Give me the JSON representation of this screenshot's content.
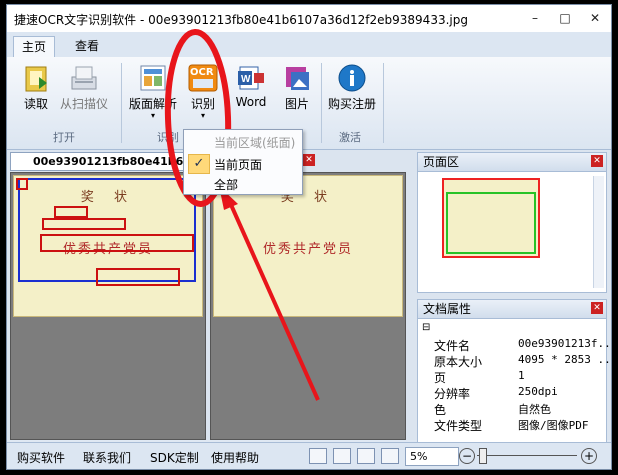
{
  "window": {
    "title": "捷速OCR文字识别软件 - 00e93901213fb80e41b6107a36d12f2eb9389433.jpg",
    "controls": [
      "–",
      "□",
      "✕"
    ]
  },
  "ribbon_tabs": [
    "主页",
    "查看"
  ],
  "ribbon": {
    "buttons": {
      "read": "读取",
      "scan": "从扫描仪",
      "layout": "版面解析",
      "recognize": "识别",
      "word": "Word",
      "image": "图片",
      "buy": "购买注册"
    },
    "groups": {
      "open": "打开",
      "recognize_group": "识别",
      "activate": "激活"
    }
  },
  "recognize_menu": {
    "items": [
      "当前区域(纸面)",
      "当前页面",
      "全部"
    ]
  },
  "document": {
    "tab_label": "00e93901213fb80e41b6107a36d12f2eb9389433.jpg",
    "cert_heading": "奖 状",
    "cert_name": "优秀共产党员"
  },
  "page_panel": {
    "title": "页面区"
  },
  "properties": {
    "title": "文档属性",
    "rows": [
      {
        "key": "文件名",
        "value": "00e93901213f..."
      },
      {
        "key": "原本大小",
        "value": "4095 * 2853 ..."
      },
      {
        "key": "页",
        "value": "1"
      },
      {
        "key": "分辨率",
        "value": "250dpi"
      },
      {
        "key": "色",
        "value": "自然色"
      },
      {
        "key": "文件类型",
        "value": "图像/图像PDF"
      }
    ]
  },
  "statusbar": {
    "links": [
      "购买软件",
      "联系我们",
      "SDK定制",
      "使用帮助"
    ],
    "zoom": "5%"
  },
  "colors": {
    "annotation_red": "#e8151b",
    "ocr_box_red": "#cc1010",
    "ocr_box_blue": "#1a2fd0"
  }
}
